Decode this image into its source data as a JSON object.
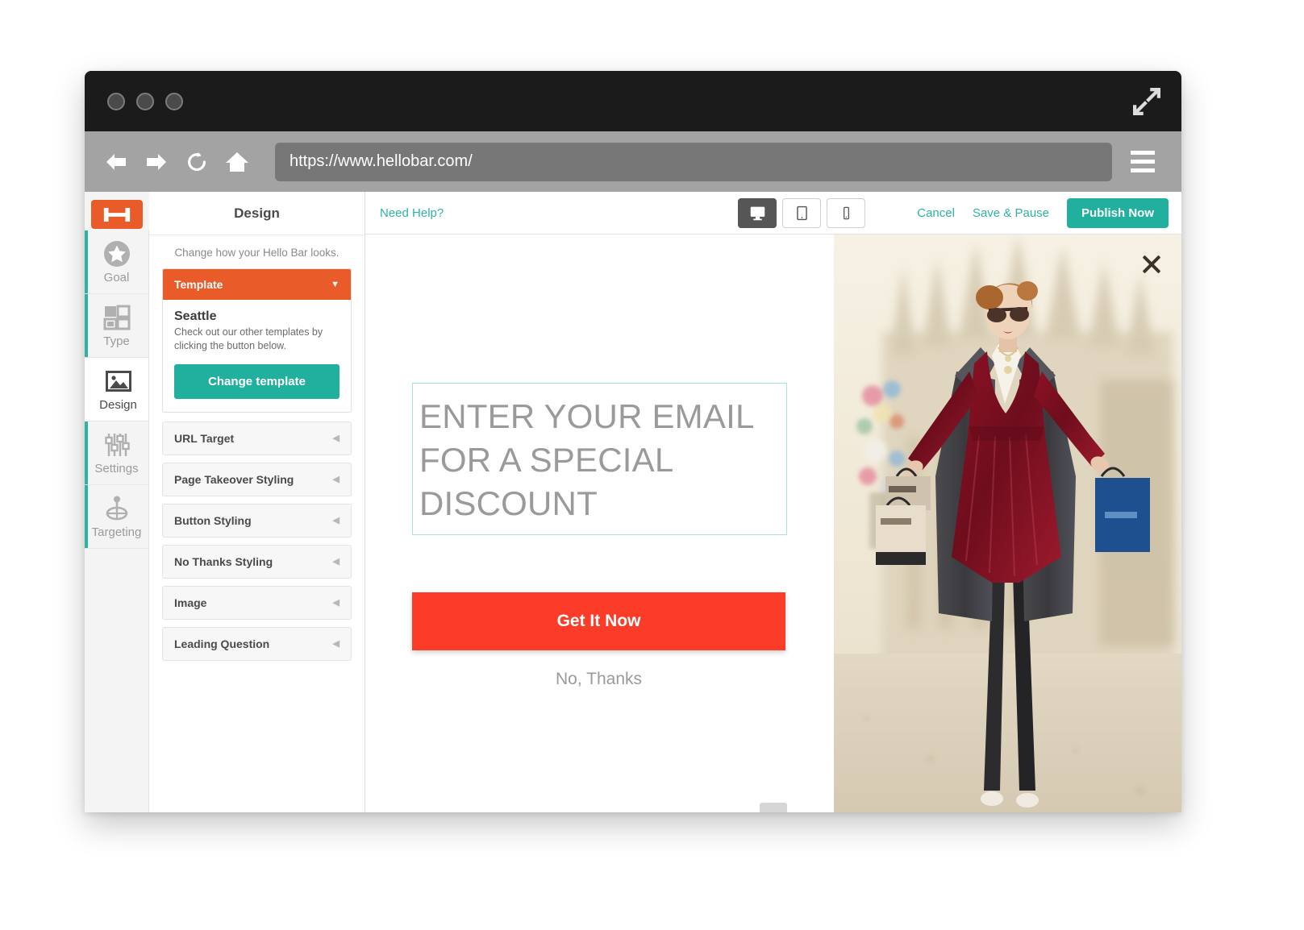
{
  "browser": {
    "url": "https://www.hellobar.com/",
    "back_icon": "arrow-left-icon",
    "forward_icon": "arrow-right-icon",
    "reload_icon": "reload-icon",
    "home_icon": "home-icon",
    "menu_icon": "hamburger-menu-icon",
    "expand_icon": "expand-icon"
  },
  "rail": {
    "logo_label": "H",
    "items": [
      {
        "label": "Goal",
        "icon": "star-icon",
        "active": false
      },
      {
        "label": "Type",
        "icon": "layout-grid-icon",
        "active": false
      },
      {
        "label": "Design",
        "icon": "image-icon",
        "active": true
      },
      {
        "label": "Settings",
        "icon": "sliders-icon",
        "active": false
      },
      {
        "label": "Targeting",
        "icon": "target-icon",
        "active": false
      }
    ]
  },
  "panel": {
    "title": "Design",
    "subtitle": "Change how your Hello Bar looks.",
    "template_section": {
      "header": "Template",
      "name": "Seattle",
      "description": "Check out our other templates by clicking the button below.",
      "button_label": "Change template"
    },
    "sections": [
      {
        "label": "URL Target"
      },
      {
        "label": "Page Takeover Styling"
      },
      {
        "label": "Button Styling"
      },
      {
        "label": "No Thanks Styling"
      },
      {
        "label": "Image"
      },
      {
        "label": "Leading Question"
      }
    ]
  },
  "toolbar": {
    "need_help": "Need Help?",
    "devices": [
      {
        "name": "desktop",
        "active": true
      },
      {
        "name": "tablet",
        "active": false
      },
      {
        "name": "mobile",
        "active": false
      }
    ],
    "cancel_label": "Cancel",
    "save_pause_label": "Save & Pause",
    "publish_label": "Publish Now"
  },
  "canvas": {
    "headline": "ENTER YOUR EMAIL FOR A SPECIAL DISCOUNT",
    "cta_label": "Get It Now",
    "no_thanks_label": "No, Thanks",
    "close_icon": "close-icon"
  },
  "colors": {
    "brand_orange": "#ea5b2a",
    "teal": "#22b09e",
    "cta_red": "#fa3c28",
    "accent_rail": "#2bb3a3"
  }
}
